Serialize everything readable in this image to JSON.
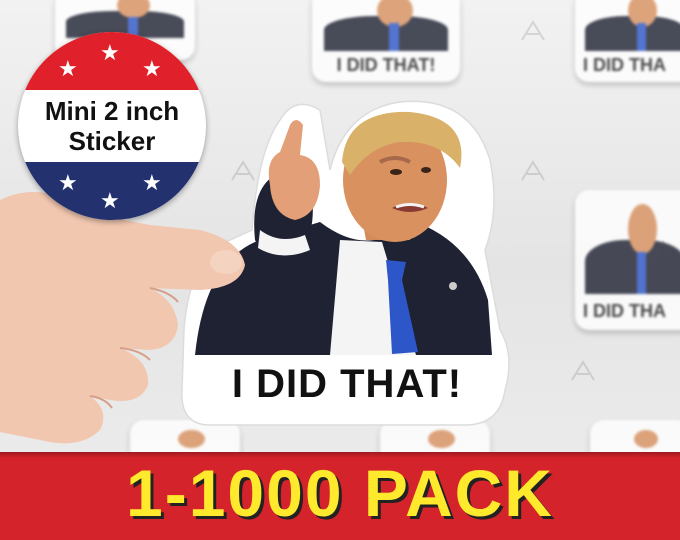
{
  "badge": {
    "line1": "Mini 2 inch",
    "line2": "Sticker",
    "colors": {
      "red": "#e0202a",
      "blue": "#23316f",
      "star": "#ffffff"
    }
  },
  "sticker": {
    "caption": "I DID THAT!",
    "colors": {
      "suit": "#1f2233",
      "tie": "#2d56c9",
      "skin": "#d9915f",
      "hair": "#d9b169"
    }
  },
  "background": {
    "sticker_captions": [
      "I DID THAT!",
      "I DID THA",
      "I DID THA"
    ]
  },
  "banner": {
    "text": "1-1000 PACK",
    "colors": {
      "background": "#d4232b",
      "text": "#ffe92d"
    }
  }
}
